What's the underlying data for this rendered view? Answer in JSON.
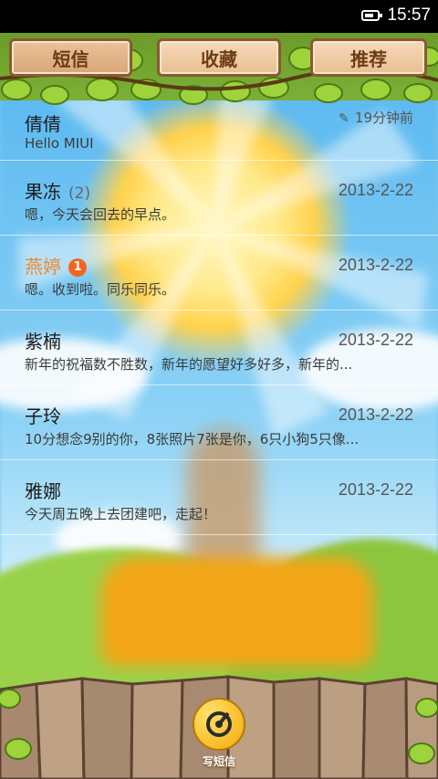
{
  "status_bar": {
    "time": "15:57"
  },
  "tabs": [
    {
      "label": "短信",
      "active": true
    },
    {
      "label": "收藏",
      "active": false
    },
    {
      "label": "推荐",
      "active": false
    }
  ],
  "conversations": [
    {
      "name": "倩倩",
      "preview": "Hello MIUI",
      "time": "19分钟前",
      "has_draft_icon": true
    },
    {
      "name": "果冻",
      "count": "(2)",
      "preview": "嗯，今天会回去的早点。",
      "time": "2013-2-22"
    },
    {
      "name": "燕婷",
      "badge": "1",
      "unread": true,
      "preview": "嗯。收到啦。同乐同乐。",
      "time": "2013-2-22"
    },
    {
      "name": "紫楠",
      "preview": "新年的祝福数不胜数，新年的愿望好多好多，新年的...",
      "time": "2013-2-22"
    },
    {
      "name": "子玲",
      "preview": "10分想念9别的你，8张照片7张是你，6只小狗5只像...",
      "time": "2013-2-22"
    },
    {
      "name": "雅娜",
      "preview": "今天周五晚上去团建吧，走起！",
      "time": "2013-2-22"
    }
  ],
  "compose": {
    "label": "写短信"
  },
  "colors": {
    "unread_name": "#ee8a2a",
    "badge": "#f2661f",
    "tab_text": "#6b3d17"
  }
}
